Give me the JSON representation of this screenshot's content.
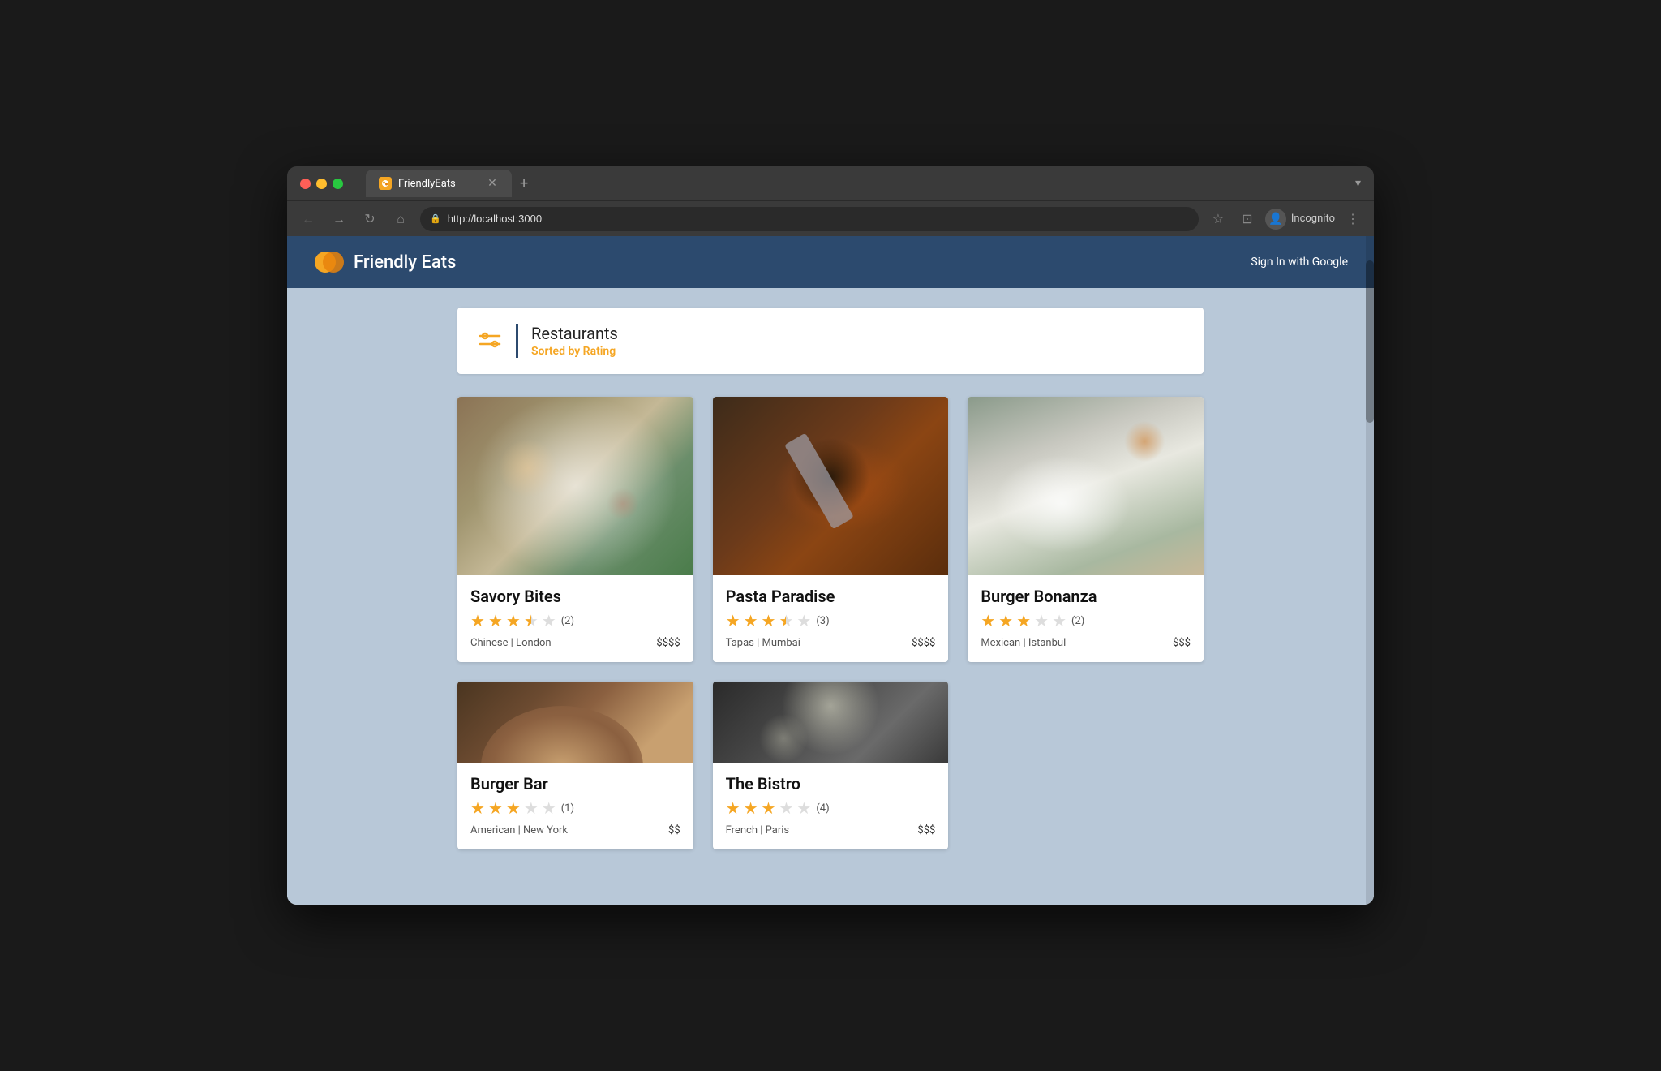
{
  "browser": {
    "tab_title": "FriendlyEats",
    "url": "http://localhost:3000",
    "incognito_label": "Incognito",
    "new_tab_symbol": "+",
    "back_symbol": "←",
    "forward_symbol": "→",
    "reload_symbol": "↻",
    "home_symbol": "⌂"
  },
  "app": {
    "title": "Friendly Eats",
    "sign_in_label": "Sign In with Google",
    "logo_color_primary": "#f5a623",
    "logo_color_secondary": "#e8820c"
  },
  "restaurants_section": {
    "title": "Restaurants",
    "subtitle": "Sorted by Rating",
    "filter_icon": "filter-icon"
  },
  "restaurants": [
    {
      "name": "Savory Bites",
      "stars_filled": 3,
      "stars_half": 1,
      "stars_empty": 1,
      "review_count": "(2)",
      "cuisine": "Chinese",
      "city": "London",
      "price": "$$$$",
      "image_class": "food-img-1",
      "rating_display": "3.5"
    },
    {
      "name": "Pasta Paradise",
      "stars_filled": 3,
      "stars_half": 1,
      "stars_empty": 1,
      "review_count": "(3)",
      "cuisine": "Tapas",
      "city": "Mumbai",
      "price": "$$$$",
      "image_class": "food-img-2",
      "rating_display": "3.5"
    },
    {
      "name": "Burger Bonanza",
      "stars_filled": 3,
      "stars_half": 0,
      "stars_empty": 2,
      "review_count": "(2)",
      "cuisine": "Mexican",
      "city": "Istanbul",
      "price": "$$$",
      "image_class": "food-img-3",
      "rating_display": "3.0"
    },
    {
      "name": "Burger Bar",
      "stars_filled": 3,
      "stars_half": 0,
      "stars_empty": 2,
      "review_count": "(1)",
      "cuisine": "American",
      "city": "New York",
      "price": "$$",
      "image_class": "food-img-4",
      "rating_display": "3.0"
    },
    {
      "name": "The Bistro",
      "stars_filled": 3,
      "stars_half": 0,
      "stars_empty": 2,
      "review_count": "(4)",
      "cuisine": "French",
      "city": "Paris",
      "price": "$$$",
      "image_class": "food-img-5",
      "rating_display": "3.0"
    }
  ]
}
